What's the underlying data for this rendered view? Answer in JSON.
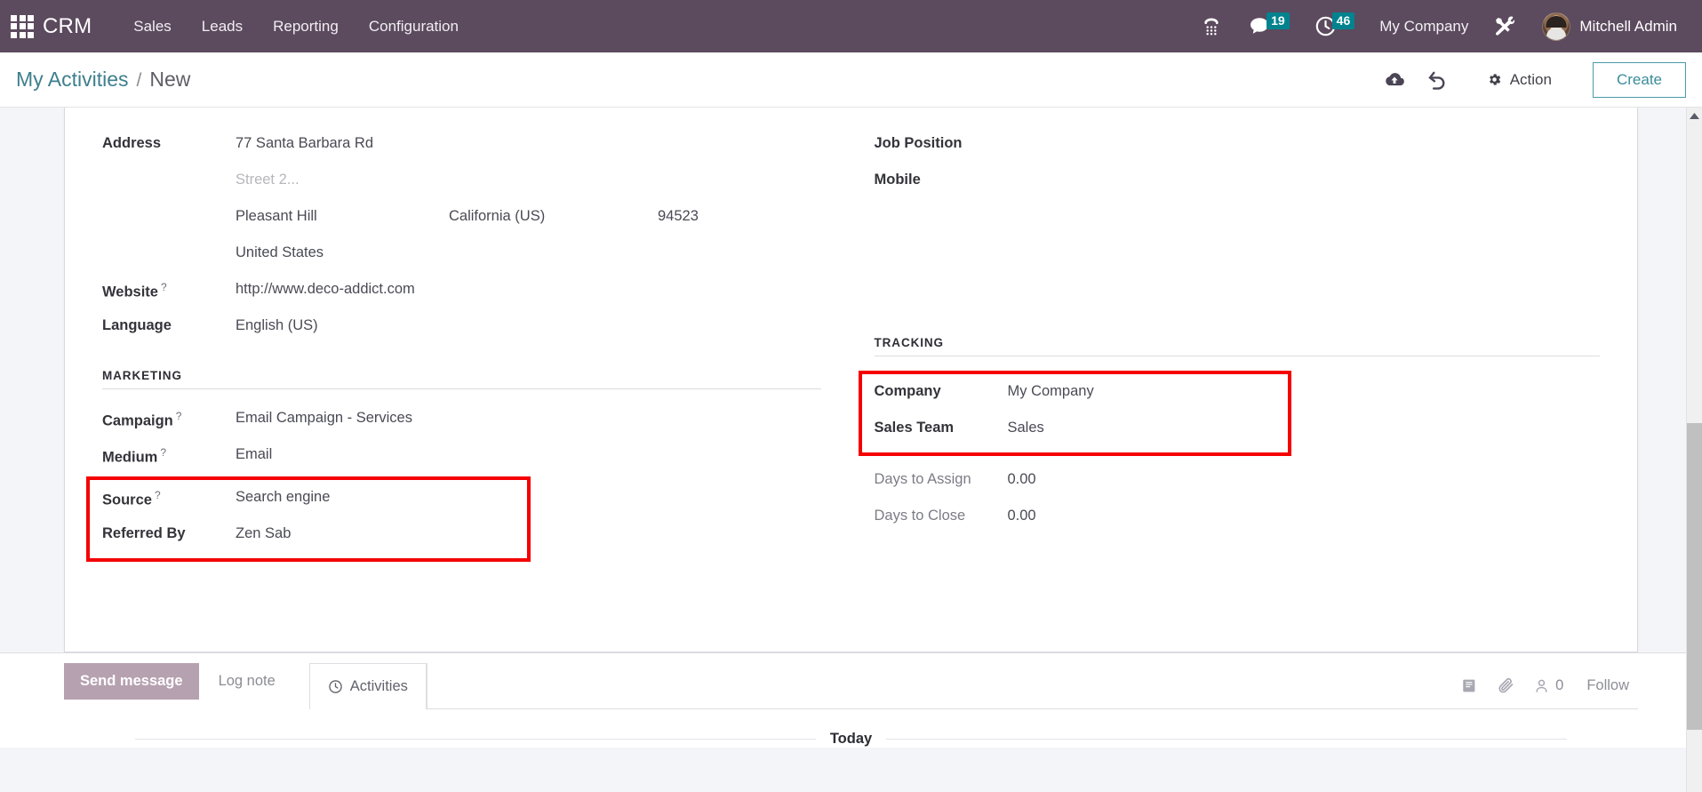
{
  "navbar": {
    "apps_icon": "apps-grid-icon",
    "brand": "CRM",
    "menu": [
      {
        "label": "Sales"
      },
      {
        "label": "Leads"
      },
      {
        "label": "Reporting"
      },
      {
        "label": "Configuration"
      }
    ],
    "sys": {
      "voip_icon": "phone-dialpad-icon",
      "messages_icon": "chat-bubble-icon",
      "messages_count": "19",
      "activities_icon": "clock-icon",
      "activities_count": "46",
      "company": "My Company",
      "tools_icon": "wrench-screwdriver-icon",
      "avatar_icon": "user-avatar",
      "user": "Mitchell Admin"
    }
  },
  "control_panel": {
    "breadcrumb_root": "My Activities",
    "breadcrumb_sep": "/",
    "breadcrumb_current": "New",
    "save_icon": "cloud-upload-icon",
    "discard_icon": "undo-icon",
    "action_icon": "gear-icon",
    "action_label": "Action",
    "create_label": "Create"
  },
  "form": {
    "left": {
      "address_label": "Address",
      "street": "77 Santa Barbara Rd",
      "street2_placeholder": "Street 2...",
      "city": "Pleasant Hill",
      "state": "California (US)",
      "zip": "94523",
      "country": "United States",
      "website_label": "Website",
      "website_value": "http://www.deco-addict.com",
      "language_label": "Language",
      "language_value": "English (US)"
    },
    "right": {
      "job_position_label": "Job Position",
      "job_position_value": "",
      "mobile_label": "Mobile",
      "mobile_value": ""
    },
    "marketing": {
      "title": "MARKETING",
      "campaign_label": "Campaign",
      "campaign_value": "Email Campaign - Services",
      "medium_label": "Medium",
      "medium_value": "Email",
      "source_label": "Source",
      "source_value": "Search engine",
      "referred_by_label": "Referred By",
      "referred_by_value": "Zen Sab"
    },
    "tracking": {
      "title": "TRACKING",
      "company_label": "Company",
      "company_value": "My Company",
      "sales_team_label": "Sales Team",
      "sales_team_value": "Sales",
      "days_to_assign_label": "Days to Assign",
      "days_to_assign_value": "0.00",
      "days_to_close_label": "Days to Close",
      "days_to_close_value": "0.00"
    },
    "help_marker": "?"
  },
  "chatter": {
    "send_message": "Send message",
    "log_note": "Log note",
    "activities_icon": "clock-icon",
    "activities": "Activities",
    "log_icon": "book-icon",
    "attachment_icon": "paperclip-icon",
    "followers_icon": "user-icon",
    "followers_count": "0",
    "follow_label": "Follow",
    "today_label": "Today"
  },
  "scrollbar": {
    "up_arrow_icon": "caret-up-icon"
  },
  "colors": {
    "navbar_bg": "#5c4a5e",
    "badge_bg": "#00838f",
    "accent_teal": "#3b8c9b",
    "highlight_red": "#f50000",
    "chatter_active_tab": "#b6a1b0"
  }
}
